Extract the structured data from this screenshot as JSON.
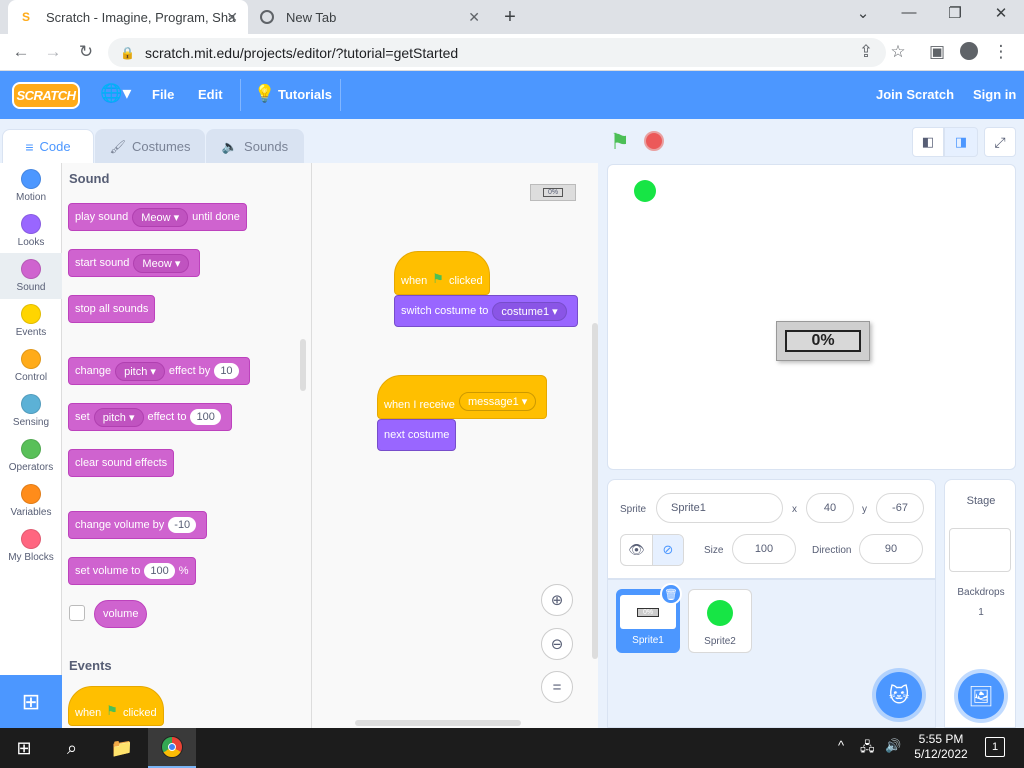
{
  "browser": {
    "active_tab_title": "Scratch - Imagine, Program, Sha",
    "new_tab_title": "New Tab",
    "url": "scratch.mit.edu/projects/editor/?tutorial=getStarted"
  },
  "menubar": {
    "logo": "SCRATCH",
    "file": "File",
    "edit": "Edit",
    "tutorials": "Tutorials",
    "join": "Join Scratch",
    "signin": "Sign in"
  },
  "editor_tabs": {
    "code": "Code",
    "costumes": "Costumes",
    "sounds": "Sounds"
  },
  "categories": [
    {
      "label": "Motion",
      "color": "#4c97ff"
    },
    {
      "label": "Looks",
      "color": "#9966ff"
    },
    {
      "label": "Sound",
      "color": "#cf63cf"
    },
    {
      "label": "Events",
      "color": "#ffd500"
    },
    {
      "label": "Control",
      "color": "#ffab19"
    },
    {
      "label": "Sensing",
      "color": "#5cb1d6"
    },
    {
      "label": "Operators",
      "color": "#59c059"
    },
    {
      "label": "Variables",
      "color": "#ff8c1a"
    },
    {
      "label": "My Blocks",
      "color": "#ff6680"
    }
  ],
  "palette": {
    "sound_header": "Sound",
    "play_sound": "play sound",
    "meow": "Meow",
    "until_done": "until done",
    "start_sound": "start sound",
    "stop_all_sounds": "stop all sounds",
    "change": "change",
    "pitch": "pitch",
    "effect_by": "effect by",
    "effect_by_val": "10",
    "set": "set",
    "effect_to": "effect to",
    "effect_to_val": "100",
    "clear_sound_effects": "clear sound effects",
    "change_volume_by": "change volume by",
    "change_volume_val": "-10",
    "set_volume_to": "set volume to",
    "set_volume_val": "100",
    "percent": "%",
    "volume": "volume",
    "events_header": "Events",
    "when": "when",
    "clicked": "clicked"
  },
  "script": {
    "when": "when",
    "clicked": "clicked",
    "switch_costume_to": "switch costume to",
    "costume1": "costume1",
    "when_i_receive": "when I receive",
    "message1": "message1",
    "next_costume": "next costume",
    "mini_label": "0%"
  },
  "stage": {
    "progress_label": "0%"
  },
  "sprite_info": {
    "sprite_label": "Sprite",
    "sprite_name": "Sprite1",
    "x_label": "x",
    "x": "40",
    "y_label": "y",
    "y": "-67",
    "show_label": "Show",
    "size_label": "Size",
    "size": "100",
    "direction_label": "Direction",
    "direction": "90"
  },
  "sprites": [
    {
      "name": "Sprite1",
      "thumb_label": "0%"
    },
    {
      "name": "Sprite2"
    }
  ],
  "stage_pane": {
    "title": "Stage",
    "backdrops_label": "Backdrops",
    "backdrops_count": "1"
  },
  "taskbar": {
    "time": "5:55 PM",
    "date": "5/12/2022",
    "notifications": "1"
  }
}
